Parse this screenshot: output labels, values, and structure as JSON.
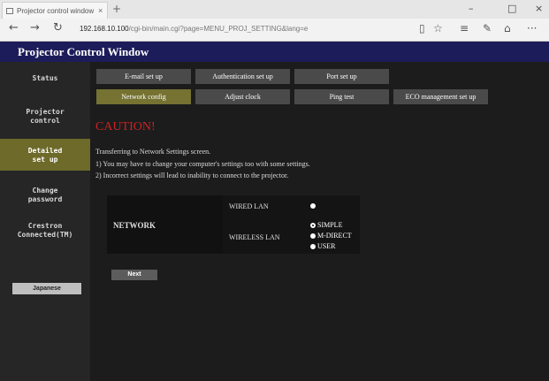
{
  "browser": {
    "tab_title": "Projector control window",
    "tab_close": "×",
    "new_tab": "+",
    "win_min": "–",
    "win_max": "□",
    "win_close": "×",
    "back": "←",
    "forward": "→",
    "refresh": "↻",
    "url_host": "192.168.10.100",
    "url_path": "/cgi-bin/main.cgi?page=MENU_PROJ_SETTING&lang=e",
    "reading_view": "▯",
    "favorite": "☆",
    "hub": "≡",
    "note": "✎",
    "share": "⌂",
    "more": "···"
  },
  "page": {
    "title": "Projector Control Window"
  },
  "sidebar": {
    "items": [
      {
        "label": "Status"
      },
      {
        "label": "Projector control"
      },
      {
        "label": "Detailed set up"
      },
      {
        "label": "Change password"
      },
      {
        "label": "Crestron Connected(TM)"
      }
    ],
    "language_button": "Japanese"
  },
  "subnav": {
    "row1": [
      "E-mail set up",
      "Authentication set up",
      "Port set up"
    ],
    "row2": [
      "Network config",
      "Adjust clock",
      "Ping test",
      "ECO management set up"
    ]
  },
  "main": {
    "caution": "CAUTION!",
    "message_intro": "Transferring to Network Settings screen.",
    "message_1": "1)  You may have to change your computer's settings too with some settings.",
    "message_2": "2)  Incorrect settings will lead to inability to connect to the projector."
  },
  "network": {
    "label": "NETWORK",
    "wired_label": "WIRED LAN",
    "wireless_label": "WIRELESS LAN",
    "wireless_options": [
      "SIMPLE",
      "M-DIRECT",
      "USER"
    ],
    "selected": "SIMPLE"
  },
  "next_button": "Next",
  "colors": {
    "header": "#1c1c5a",
    "active_tab": "#757232",
    "caution": "#cc2222"
  }
}
